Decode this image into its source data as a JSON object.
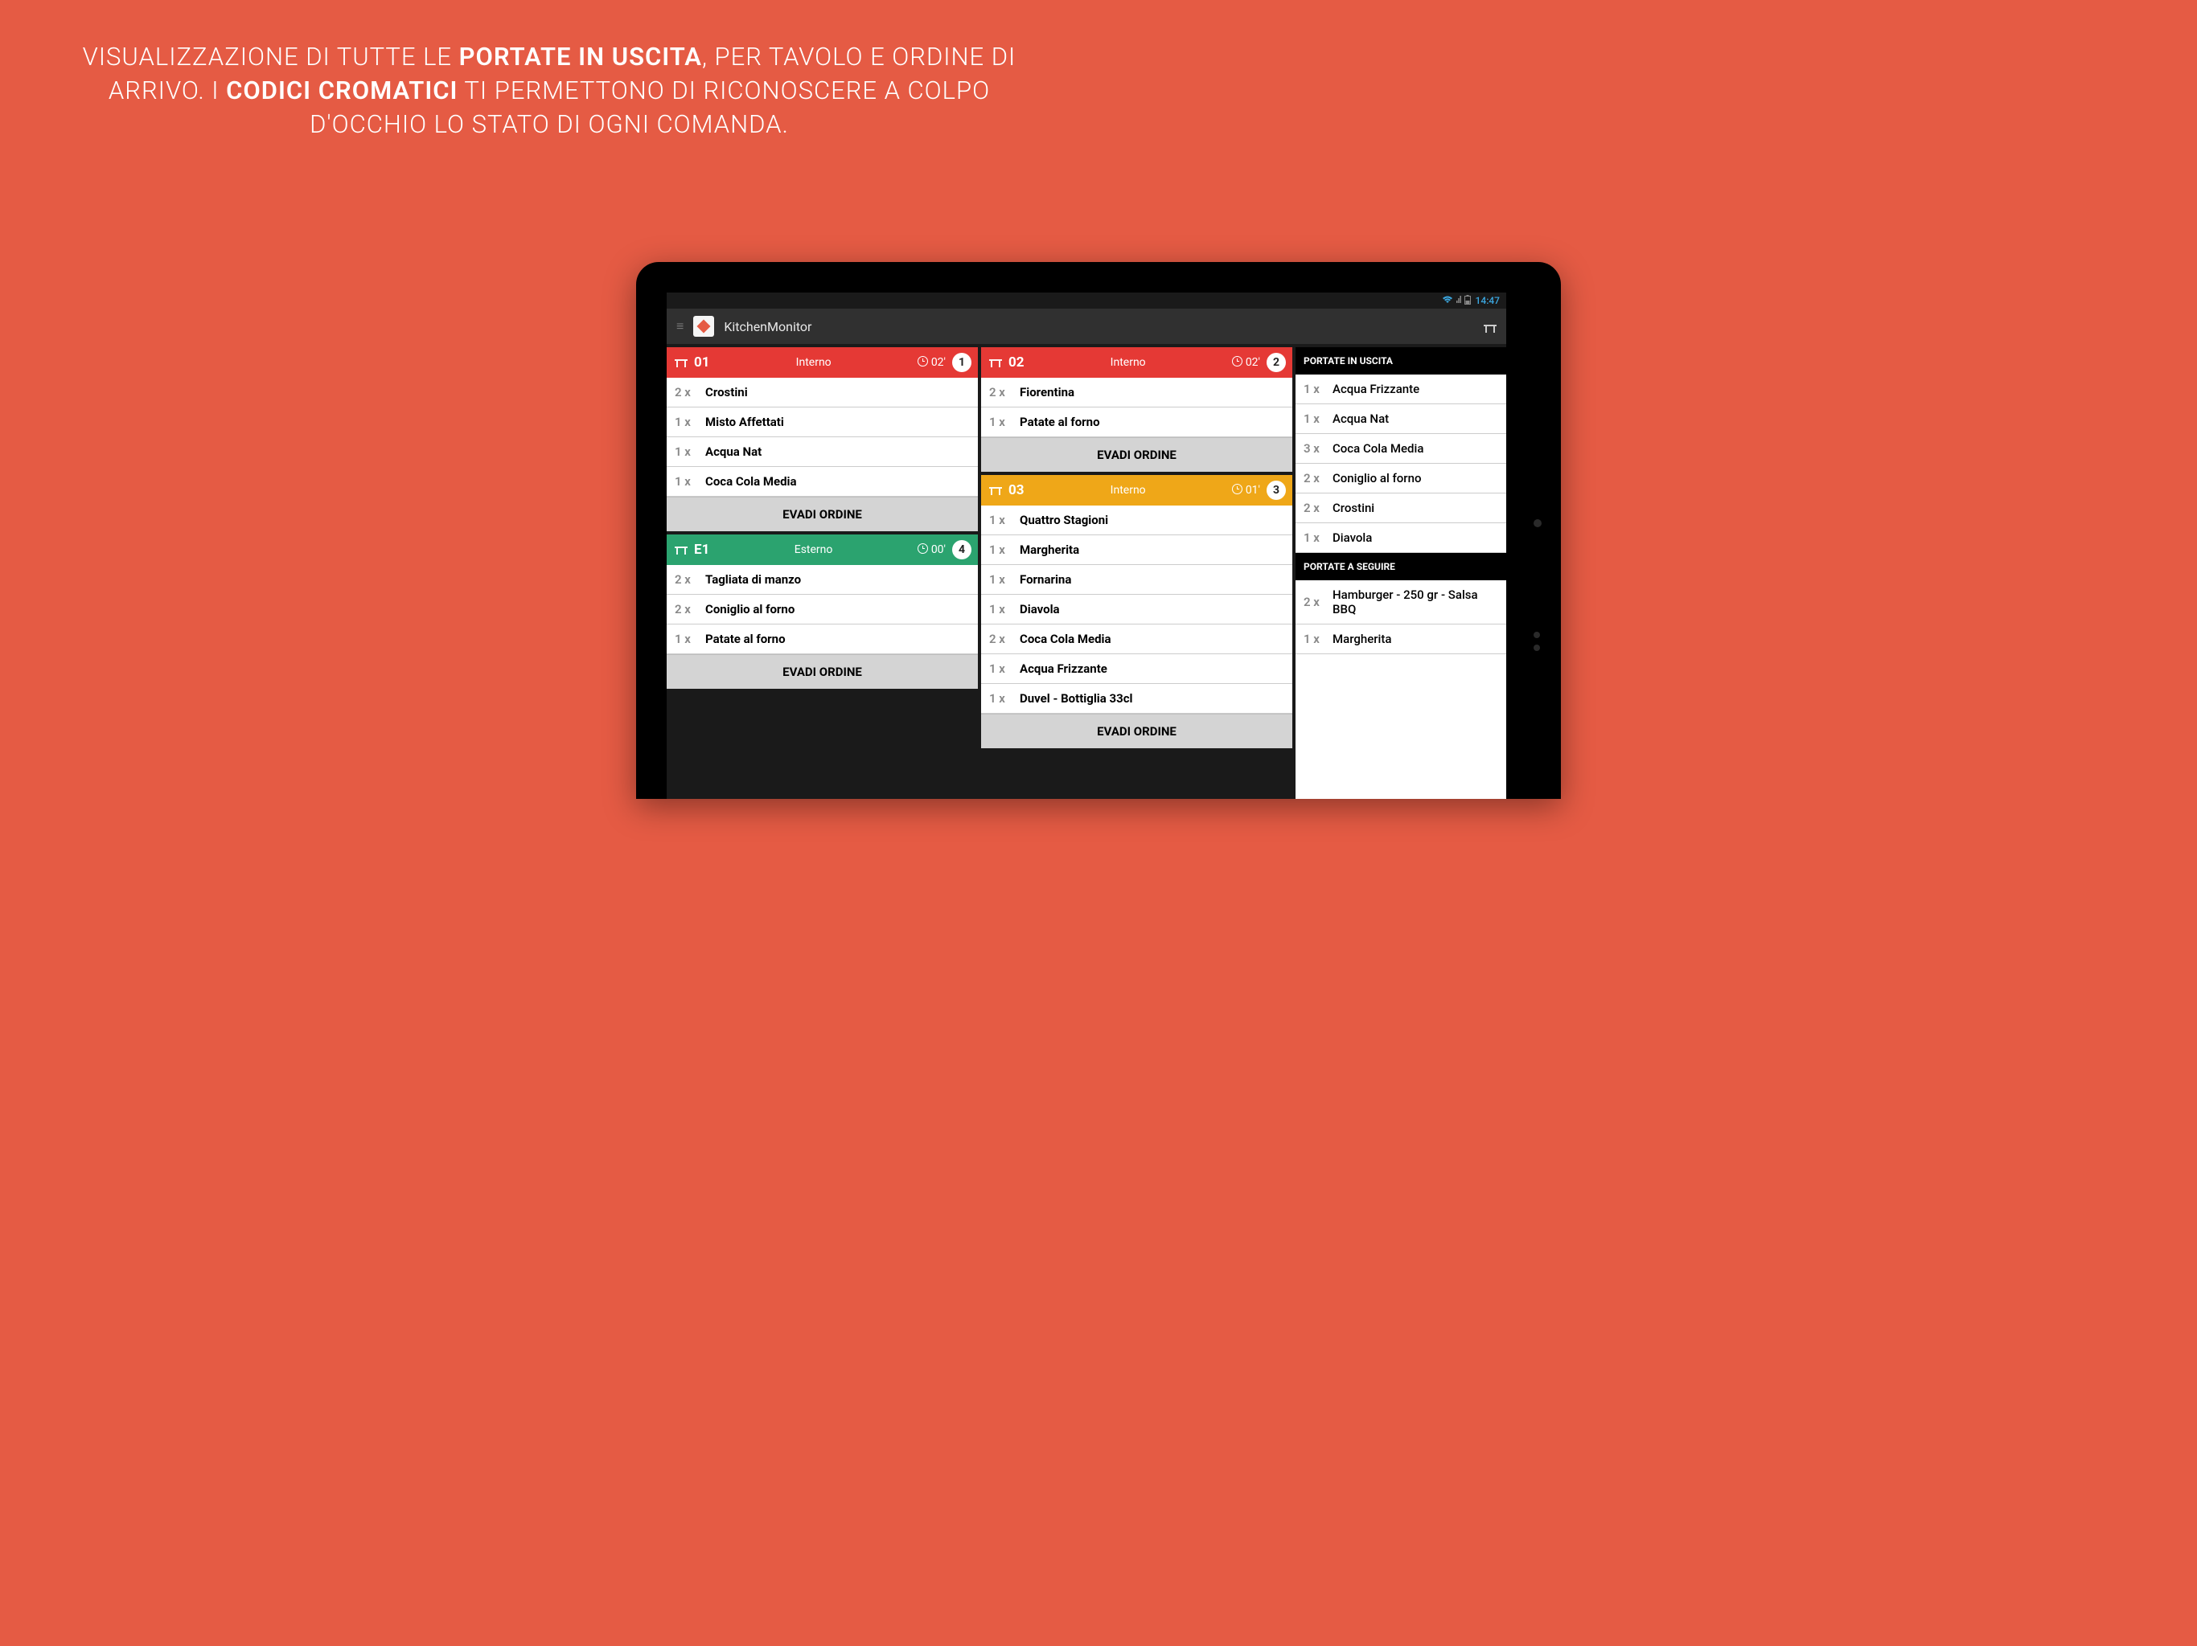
{
  "promo": {
    "t1": "VISUALIZZAZIONE DI TUTTE LE ",
    "b1": "PORTATE IN USCITA",
    "t2": ", PER TAVOLO E ORDINE DI ARRIVO. I ",
    "b2": "CODICI CROMATICI",
    "t3": " TI PERMETTONO DI RICONOSCERE A COLPO D'OCCHIO LO STATO DI OGNI COMANDA."
  },
  "status_bar": {
    "time": "14:47"
  },
  "app": {
    "title": "KitchenMonitor"
  },
  "evadiLabel": "EVADI ORDINE",
  "orders": {
    "o1": {
      "table": "01",
      "zone": "Interno",
      "time": "02'",
      "seq": "1",
      "items": [
        {
          "qty": "2 x",
          "name": "Crostini"
        },
        {
          "qty": "1 x",
          "name": "Misto Affettati"
        },
        {
          "qty": "1 x",
          "name": "Acqua Nat"
        },
        {
          "qty": "1 x",
          "name": "Coca Cola Media"
        }
      ]
    },
    "o2": {
      "table": "E1",
      "zone": "Esterno",
      "time": "00'",
      "seq": "4",
      "items": [
        {
          "qty": "2 x",
          "name": "Tagliata di manzo"
        },
        {
          "qty": "2 x",
          "name": "Coniglio al forno"
        },
        {
          "qty": "1 x",
          "name": "Patate al forno"
        }
      ]
    },
    "o3": {
      "table": "02",
      "zone": "Interno",
      "time": "02'",
      "seq": "2",
      "items": [
        {
          "qty": "2 x",
          "name": "Fiorentina"
        },
        {
          "qty": "1 x",
          "name": "Patate al forno"
        }
      ]
    },
    "o4": {
      "table": "03",
      "zone": "Interno",
      "time": "01'",
      "seq": "3",
      "items": [
        {
          "qty": "1 x",
          "name": "Quattro Stagioni"
        },
        {
          "qty": "1 x",
          "name": "Margherita"
        },
        {
          "qty": "1 x",
          "name": "Fornarina"
        },
        {
          "qty": "1 x",
          "name": "Diavola"
        },
        {
          "qty": "2 x",
          "name": "Coca Cola Media"
        },
        {
          "qty": "1 x",
          "name": "Acqua Frizzante"
        },
        {
          "qty": "1 x",
          "name": "Duvel - Bottiglia 33cl"
        }
      ]
    }
  },
  "sidebar": {
    "section1": {
      "title": "PORTATE IN USCITA",
      "items": [
        {
          "qty": "1 x",
          "name": "Acqua Frizzante"
        },
        {
          "qty": "1 x",
          "name": "Acqua Nat"
        },
        {
          "qty": "3 x",
          "name": "Coca Cola Media"
        },
        {
          "qty": "2 x",
          "name": "Coniglio al forno"
        },
        {
          "qty": "2 x",
          "name": "Crostini"
        },
        {
          "qty": "1 x",
          "name": "Diavola"
        }
      ]
    },
    "section2": {
      "title": "PORTATE A SEGUIRE",
      "items": [
        {
          "qty": "2 x",
          "name": "Hamburger - 250 gr - Salsa BBQ"
        },
        {
          "qty": "1 x",
          "name": "Margherita"
        }
      ]
    }
  }
}
